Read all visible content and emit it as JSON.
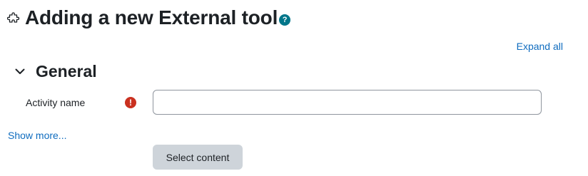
{
  "header": {
    "title": "Adding a new External tool",
    "help_icon": "?"
  },
  "actions": {
    "expand_all": "Expand all"
  },
  "section": {
    "title": "General"
  },
  "form": {
    "activity_name_label": "Activity name",
    "activity_name_value": "",
    "required_icon": "!",
    "show_more": "Show more...",
    "select_content": "Select content"
  },
  "colors": {
    "link": "#0f6cbf",
    "help": "#00768a",
    "required": "#ca3120",
    "button_bg": "#ced4da"
  }
}
